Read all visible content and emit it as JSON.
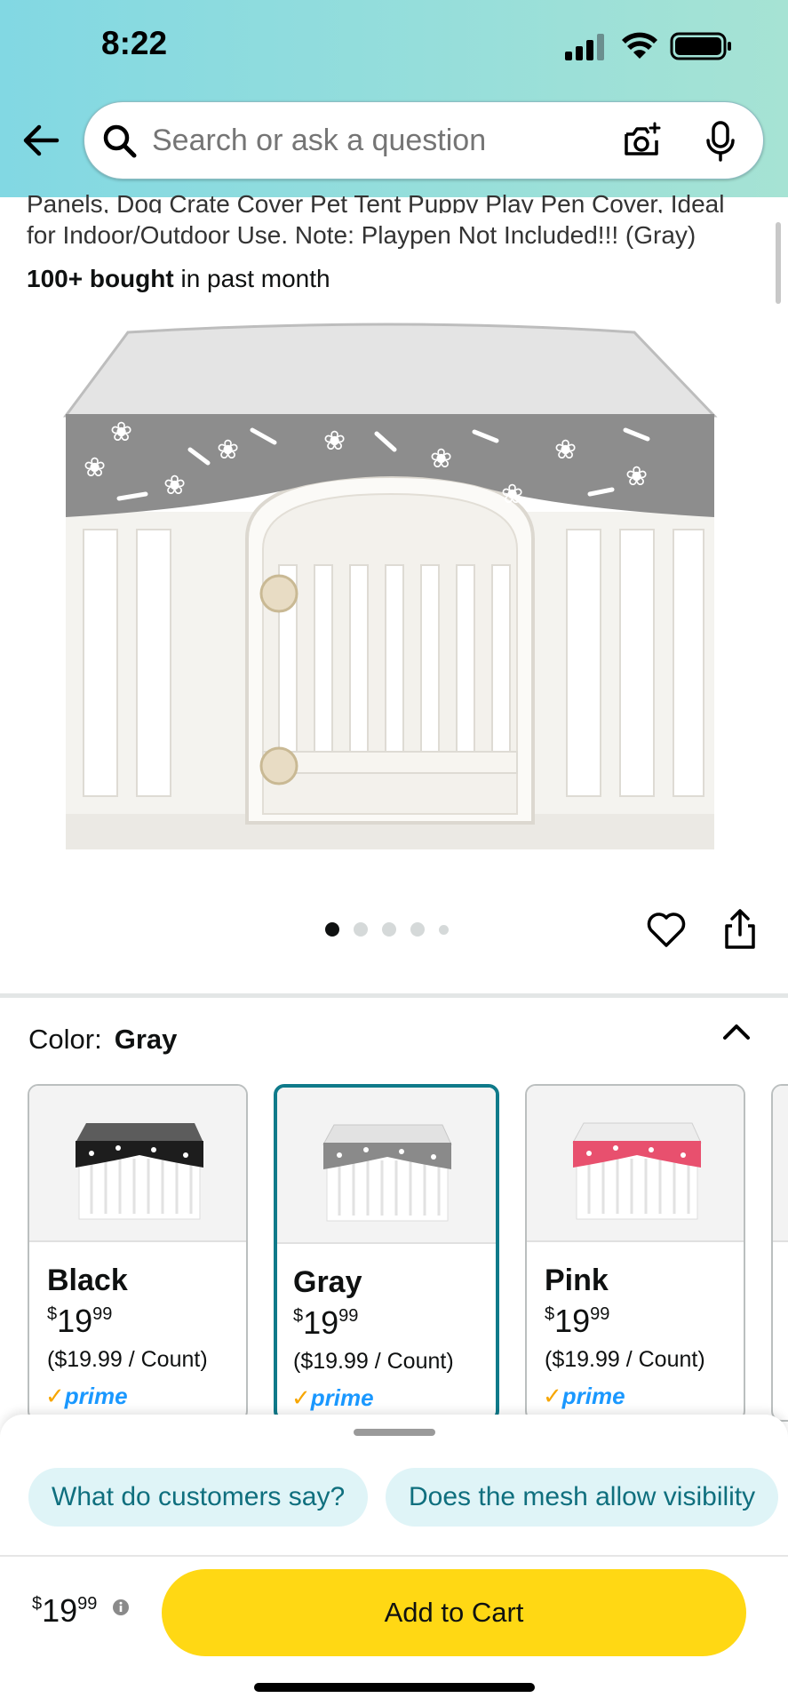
{
  "status_bar": {
    "time": "8:22"
  },
  "search": {
    "placeholder": "Search or ask a question"
  },
  "product": {
    "title_line1": "Panels, Dog Crate Cover Pet Tent Puppy Play Pen Cover, Ideal",
    "title_line2": "for Indoor/Outdoor Use. Note: Playpen Not Included!!! (Gray)",
    "bought_bold": "100+ bought",
    "bought_rest": " in past month",
    "image_count": 5,
    "active_image": 1
  },
  "color": {
    "label": "Color:",
    "selected": "Gray",
    "options": [
      {
        "name": "Black",
        "price_whole": "19",
        "price_cents": "99",
        "currency": "$",
        "unit": "($19.99 / Count)",
        "prime": "prime",
        "accent": "#1d1d1d"
      },
      {
        "name": "Gray",
        "price_whole": "19",
        "price_cents": "99",
        "currency": "$",
        "unit": "($19.99 / Count)",
        "prime": "prime",
        "accent": "#8a8a8a"
      },
      {
        "name": "Pink",
        "price_whole": "19",
        "price_cents": "99",
        "currency": "$",
        "unit": "($19.99 / Count)",
        "prime": "prime",
        "accent": "#e8506e"
      }
    ]
  },
  "questions": [
    "What do customers say?",
    "Does the mesh allow visibility"
  ],
  "buy_box": {
    "currency": "$",
    "price_whole": "19",
    "price_cents": "99",
    "add_to_cart": "Add to Cart"
  },
  "colors": {
    "accent_teal": "#0f7a8a",
    "cart_yellow": "#ffd814",
    "prime_blue": "#1a98ff"
  }
}
